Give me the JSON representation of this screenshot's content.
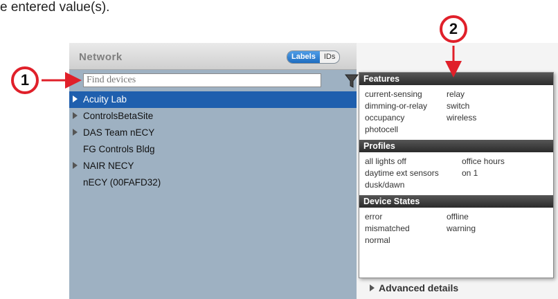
{
  "intro": {
    "text": "e entered value(s)."
  },
  "callouts": [
    {
      "label": "1"
    },
    {
      "label": "2"
    }
  ],
  "colors": {
    "callout_red": "#e0202a",
    "selected_blue": "#1f5fae",
    "panel_bg": "#9eb1c2"
  },
  "network": {
    "title": "Network",
    "toggle": {
      "labels": "Labels",
      "ids": "IDs",
      "selected": "Labels"
    },
    "search": {
      "placeholder": "Find devices"
    },
    "items": [
      {
        "label": "Acuity Lab",
        "expandable": true,
        "selected": true
      },
      {
        "label": "ControlsBetaSite",
        "expandable": true
      },
      {
        "label": "DAS Team nECY",
        "expandable": true
      },
      {
        "label": "FG Controls Bldg",
        "expandable": false
      },
      {
        "label": "NAIR NECY",
        "expandable": true
      },
      {
        "label": "nECY (00FAFD32)",
        "expandable": false
      }
    ]
  },
  "filter": {
    "features": {
      "title": "Features",
      "items": [
        "current-sensing",
        "relay",
        "dimming-or-relay",
        "switch",
        "occupancy",
        "wireless",
        "photocell"
      ]
    },
    "profiles": {
      "title": "Profiles",
      "items": [
        "all lights off",
        "office hours",
        "daytime ext sensors",
        "on 1",
        "dusk/dawn"
      ]
    },
    "states": {
      "title": "Device States",
      "items": [
        "error",
        "offline",
        "mismatched",
        "warning",
        "normal"
      ]
    }
  },
  "advanced": {
    "label": "Advanced details"
  }
}
